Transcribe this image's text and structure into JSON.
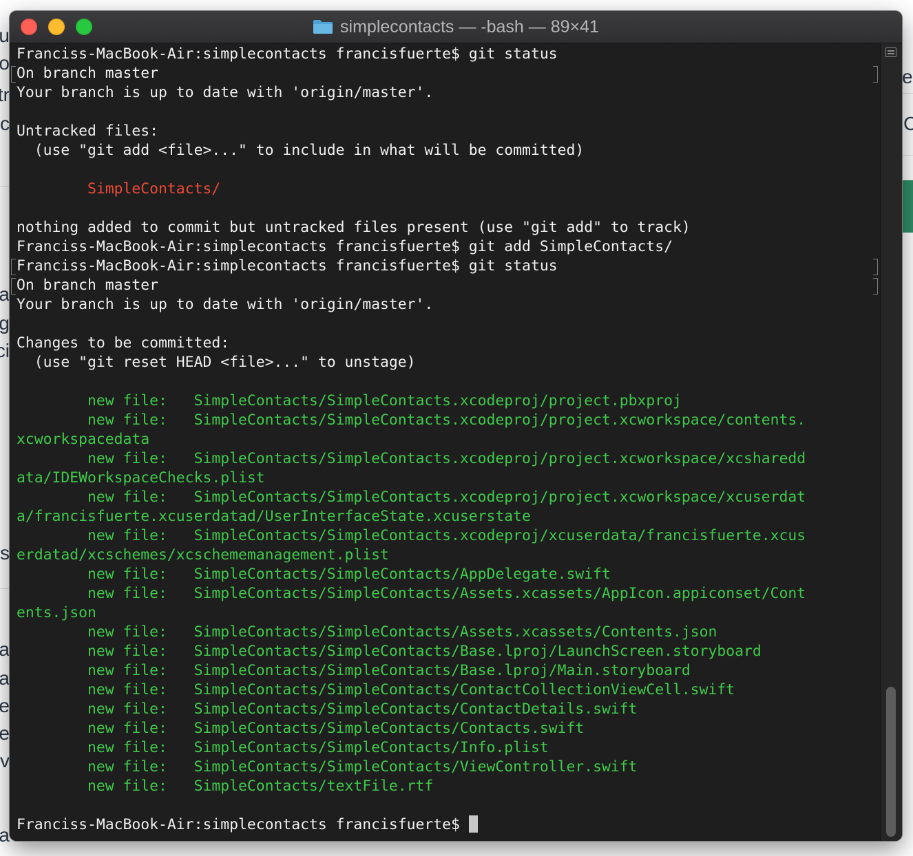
{
  "background": {
    "fragments": [
      "u",
      "o",
      "tr",
      "c",
      "el",
      "C",
      "a",
      "ng",
      "ci",
      "n",
      "e s",
      "a",
      "a",
      "e",
      "e",
      "ev",
      "ca"
    ]
  },
  "window": {
    "title": "simplecontacts — -bash — 89×41",
    "folder_icon": "folder-icon"
  },
  "terminal": {
    "lines": [
      {
        "text": "Franciss-MacBook-Air:simplecontacts francisfuerte$ git status",
        "color": "default",
        "marked": false
      },
      {
        "text": "On branch master",
        "color": "default",
        "marked": true
      },
      {
        "text": "Your branch is up to date with 'origin/master'.",
        "color": "default",
        "marked": false
      },
      {
        "text": "",
        "color": "default",
        "marked": false
      },
      {
        "text": "Untracked files:",
        "color": "default",
        "marked": false
      },
      {
        "text": "  (use \"git add <file>...\" to include in what will be committed)",
        "color": "default",
        "marked": false
      },
      {
        "text": "",
        "color": "default",
        "marked": false
      },
      {
        "text": "        SimpleContacts/",
        "color": "red",
        "marked": false
      },
      {
        "text": "",
        "color": "default",
        "marked": false
      },
      {
        "text": "nothing added to commit but untracked files present (use \"git add\" to track)",
        "color": "default",
        "marked": false
      },
      {
        "text": "Franciss-MacBook-Air:simplecontacts francisfuerte$ git add SimpleContacts/",
        "color": "default",
        "marked": false
      },
      {
        "text": "Franciss-MacBook-Air:simplecontacts francisfuerte$ git status",
        "color": "default",
        "marked": true
      },
      {
        "text": "On branch master",
        "color": "default",
        "marked": true
      },
      {
        "text": "Your branch is up to date with 'origin/master'.",
        "color": "default",
        "marked": false
      },
      {
        "text": "",
        "color": "default",
        "marked": false
      },
      {
        "text": "Changes to be committed:",
        "color": "default",
        "marked": false
      },
      {
        "text": "  (use \"git reset HEAD <file>...\" to unstage)",
        "color": "default",
        "marked": false
      },
      {
        "text": "",
        "color": "default",
        "marked": false
      },
      {
        "text": "        new file:   SimpleContacts/SimpleContacts.xcodeproj/project.pbxproj",
        "color": "green",
        "marked": false
      },
      {
        "text": "        new file:   SimpleContacts/SimpleContacts.xcodeproj/project.xcworkspace/contents.",
        "color": "green",
        "marked": false
      },
      {
        "text": "xcworkspacedata",
        "color": "green",
        "marked": false
      },
      {
        "text": "        new file:   SimpleContacts/SimpleContacts.xcodeproj/project.xcworkspace/xcsharedd",
        "color": "green",
        "marked": false
      },
      {
        "text": "ata/IDEWorkspaceChecks.plist",
        "color": "green",
        "marked": false
      },
      {
        "text": "        new file:   SimpleContacts/SimpleContacts.xcodeproj/project.xcworkspace/xcuserdat",
        "color": "green",
        "marked": false
      },
      {
        "text": "a/francisfuerte.xcuserdatad/UserInterfaceState.xcuserstate",
        "color": "green",
        "marked": false
      },
      {
        "text": "        new file:   SimpleContacts/SimpleContacts.xcodeproj/xcuserdata/francisfuerte.xcus",
        "color": "green",
        "marked": false
      },
      {
        "text": "erdatad/xcschemes/xcschememanagement.plist",
        "color": "green",
        "marked": false
      },
      {
        "text": "        new file:   SimpleContacts/SimpleContacts/AppDelegate.swift",
        "color": "green",
        "marked": false
      },
      {
        "text": "        new file:   SimpleContacts/SimpleContacts/Assets.xcassets/AppIcon.appiconset/Cont",
        "color": "green",
        "marked": false
      },
      {
        "text": "ents.json",
        "color": "green",
        "marked": false
      },
      {
        "text": "        new file:   SimpleContacts/SimpleContacts/Assets.xcassets/Contents.json",
        "color": "green",
        "marked": false
      },
      {
        "text": "        new file:   SimpleContacts/SimpleContacts/Base.lproj/LaunchScreen.storyboard",
        "color": "green",
        "marked": false
      },
      {
        "text": "        new file:   SimpleContacts/SimpleContacts/Base.lproj/Main.storyboard",
        "color": "green",
        "marked": false
      },
      {
        "text": "        new file:   SimpleContacts/SimpleContacts/ContactCollectionViewCell.swift",
        "color": "green",
        "marked": false
      },
      {
        "text": "        new file:   SimpleContacts/SimpleContacts/ContactDetails.swift",
        "color": "green",
        "marked": false
      },
      {
        "text": "        new file:   SimpleContacts/SimpleContacts/Contacts.swift",
        "color": "green",
        "marked": false
      },
      {
        "text": "        new file:   SimpleContacts/SimpleContacts/Info.plist",
        "color": "green",
        "marked": false
      },
      {
        "text": "        new file:   SimpleContacts/SimpleContacts/ViewController.swift",
        "color": "green",
        "marked": false
      },
      {
        "text": "        new file:   SimpleContacts/textFile.rtf",
        "color": "green",
        "marked": false
      },
      {
        "text": "",
        "color": "default",
        "marked": false
      },
      {
        "text": "Franciss-MacBook-Air:simplecontacts francisfuerte$ ",
        "color": "default",
        "marked": false,
        "cursor": true
      }
    ]
  },
  "colors": {
    "default": "#f0f0f0",
    "red": "#f04a35",
    "green": "#3fca4a",
    "close": "#fe5f57",
    "minimize": "#febc2e",
    "maximize": "#28c840"
  }
}
